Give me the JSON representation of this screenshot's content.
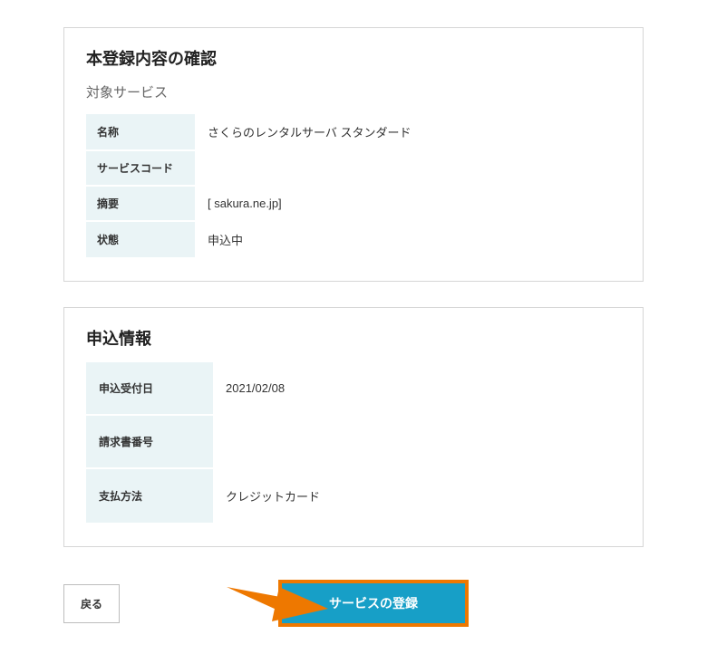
{
  "confirmation": {
    "title": "本登録内容の確認",
    "subheading": "対象サービス",
    "rows": {
      "name_label": "名称",
      "name_value": "さくらのレンタルサーバ スタンダード",
      "service_code_label": "サービスコード",
      "service_code_value": "",
      "summary_label": "摘要",
      "summary_value": "[              sakura.ne.jp]",
      "status_label": "状態",
      "status_value": "申込中"
    }
  },
  "application": {
    "title": "申込情報",
    "rows": {
      "received_label": "申込受付日",
      "received_value": "2021/02/08",
      "invoice_label": "請求書番号",
      "invoice_value": "",
      "payment_label": "支払方法",
      "payment_value": "クレジットカード"
    }
  },
  "buttons": {
    "back": "戻る",
    "register": "サービスの登録"
  },
  "colors": {
    "accent": "#179fc7",
    "highlight_border": "#ee7800",
    "arrow": "#ee7800"
  }
}
